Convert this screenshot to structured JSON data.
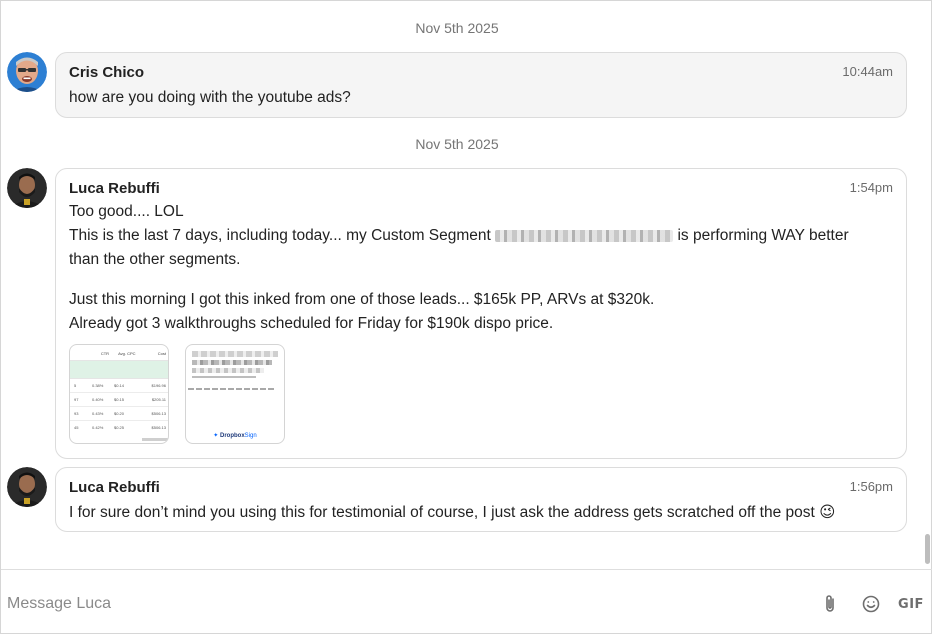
{
  "thread": {
    "separators": [
      {
        "label": "Nov 5th 2025"
      },
      {
        "label": "Nov 5th 2025"
      }
    ],
    "messages": [
      {
        "sender": "Cris Chico",
        "time": "10:44am",
        "lines": [
          "how are you doing with the youtube ads?"
        ]
      },
      {
        "sender": "Luca Rebuffi",
        "time": "1:54pm",
        "lines": [
          "Too good.... LOL",
          "This is the last 7 days, including today... my Custom Segment",
          "is performing WAY better",
          "than the other segments.",
          "Just this morning I got this inked from one of those leads... $165k PP, ARVs at $320k.",
          "Already got 3 walkthroughs scheduled for Friday for $190k dispo price."
        ],
        "attachments": {
          "spreadsheet": {
            "headers": [
              "CTR",
              "Avg. CPC",
              "Cost"
            ],
            "rows": [
              [
                "5",
                "0.38%",
                "$0.14",
                "$196.96"
              ],
              [
                "97",
                "0.40%",
                "$0.15",
                "$205.11"
              ],
              [
                "93",
                "0.43%",
                "$0.20",
                "$506.13"
              ],
              [
                "45",
                "0.42%",
                "$0.25",
                "$506.13"
              ]
            ]
          },
          "document": {
            "brand": "Dropbox",
            "brand_suffix": "Sign"
          }
        }
      },
      {
        "sender": "Luca Rebuffi",
        "time": "1:56pm",
        "lines": [
          "I for sure don’t mind you using this for testimonial of course, I just ask the address gets scratched off the post"
        ],
        "emoji": "😉"
      }
    ]
  },
  "composer": {
    "placeholder": "Message Luca",
    "gif_label": "GIF",
    "icons": [
      "paperclip-icon",
      "emoji-icon"
    ]
  },
  "colors": {
    "bubble_grey": "#f5f5f5",
    "border": "#dcdcdc",
    "muted_text": "#757575",
    "cris_avatar_bg": "#2d7fd3"
  }
}
